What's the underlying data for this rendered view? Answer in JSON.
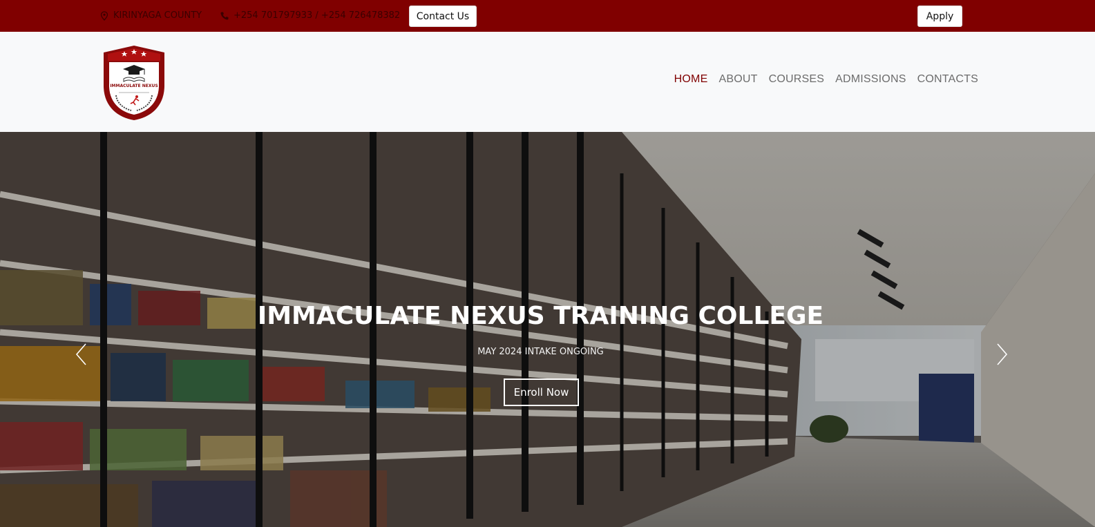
{
  "topbar": {
    "location": "KIRINYAGA COUNTY",
    "phone": "+254 701797933 / +254 726478382",
    "contact_button": "Contact Us",
    "apply_button": "Apply",
    "location_icon": "location-pin-icon",
    "phone_icon": "phone-icon"
  },
  "header": {
    "logo_name": "IMMACULATE NEXUS",
    "nav": [
      {
        "label": "HOME",
        "active": true
      },
      {
        "label": "ABOUT",
        "active": false
      },
      {
        "label": "COURSES",
        "active": false
      },
      {
        "label": "ADMISSIONS",
        "active": false
      },
      {
        "label": "CONTACTS",
        "active": false
      }
    ]
  },
  "hero": {
    "title": "IMMACULATE NEXUS TRAINING COLLEGE",
    "subtitle": "MAY 2024 INTAKE ONGOING",
    "enroll_button": "Enroll Now",
    "prev_icon": "chevron-left-icon",
    "next_icon": "chevron-right-icon"
  },
  "colors": {
    "brand": "#800000",
    "header_bg": "#f8f9fa",
    "nav_text": "#6c6c6c"
  }
}
